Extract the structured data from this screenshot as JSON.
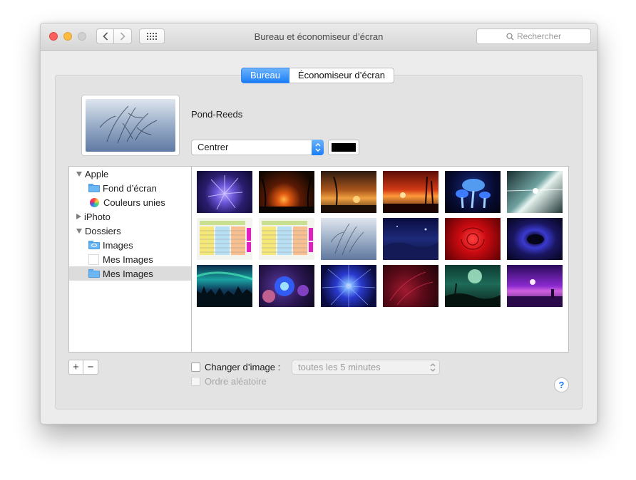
{
  "window": {
    "title": "Bureau et économiseur d’écran"
  },
  "toolbar": {
    "search_placeholder": "Rechercher"
  },
  "tabs": [
    {
      "label": "Bureau",
      "active": true
    },
    {
      "label": "Économiseur d’écran",
      "active": false
    }
  ],
  "current_wallpaper": {
    "name": "Pond-Reeds"
  },
  "fit_menu": {
    "selected": "Centrer"
  },
  "bg_color": "#000000",
  "sidebar": {
    "apple": {
      "label": "Apple",
      "children": [
        {
          "label": "Fond d’écran",
          "icon": "folder-icon"
        },
        {
          "label": "Couleurs unies",
          "icon": "color-wheel-icon"
        }
      ]
    },
    "iphoto": {
      "label": "iPhoto"
    },
    "dossiers": {
      "label": "Dossiers",
      "children": [
        {
          "label": "Images",
          "icon": "pictures-folder-icon"
        },
        {
          "label": "Mes Images",
          "icon": "blank-file-icon"
        },
        {
          "label": "Mes Images",
          "icon": "folder-icon",
          "selected": true
        }
      ]
    }
  },
  "thumbnails": [
    {
      "icon": "purple-flower-fractal"
    },
    {
      "icon": "sunset-palms-dark"
    },
    {
      "icon": "sunset-palms-orange"
    },
    {
      "icon": "red-sunset-trees"
    },
    {
      "icon": "glowing-mushrooms"
    },
    {
      "icon": "light-beam-space"
    },
    {
      "icon": "calendar-chart"
    },
    {
      "icon": "calendar-chart"
    },
    {
      "icon": "pond-reeds"
    },
    {
      "icon": "blue-night-landscape"
    },
    {
      "icon": "red-rose"
    },
    {
      "icon": "blue-vortex"
    },
    {
      "icon": "aurora-forest"
    },
    {
      "icon": "fractal-spheres"
    },
    {
      "icon": "blue-starburst"
    },
    {
      "icon": "red-fractal"
    },
    {
      "icon": "moon-island"
    },
    {
      "icon": "purple-moon-lake"
    }
  ],
  "controls": {
    "add_label": "+",
    "remove_label": "−",
    "change_picture_label": "Changer d’image :",
    "interval": "toutes les 5 minutes",
    "random_order_label": "Ordre aléatoire",
    "help_label": "?"
  }
}
